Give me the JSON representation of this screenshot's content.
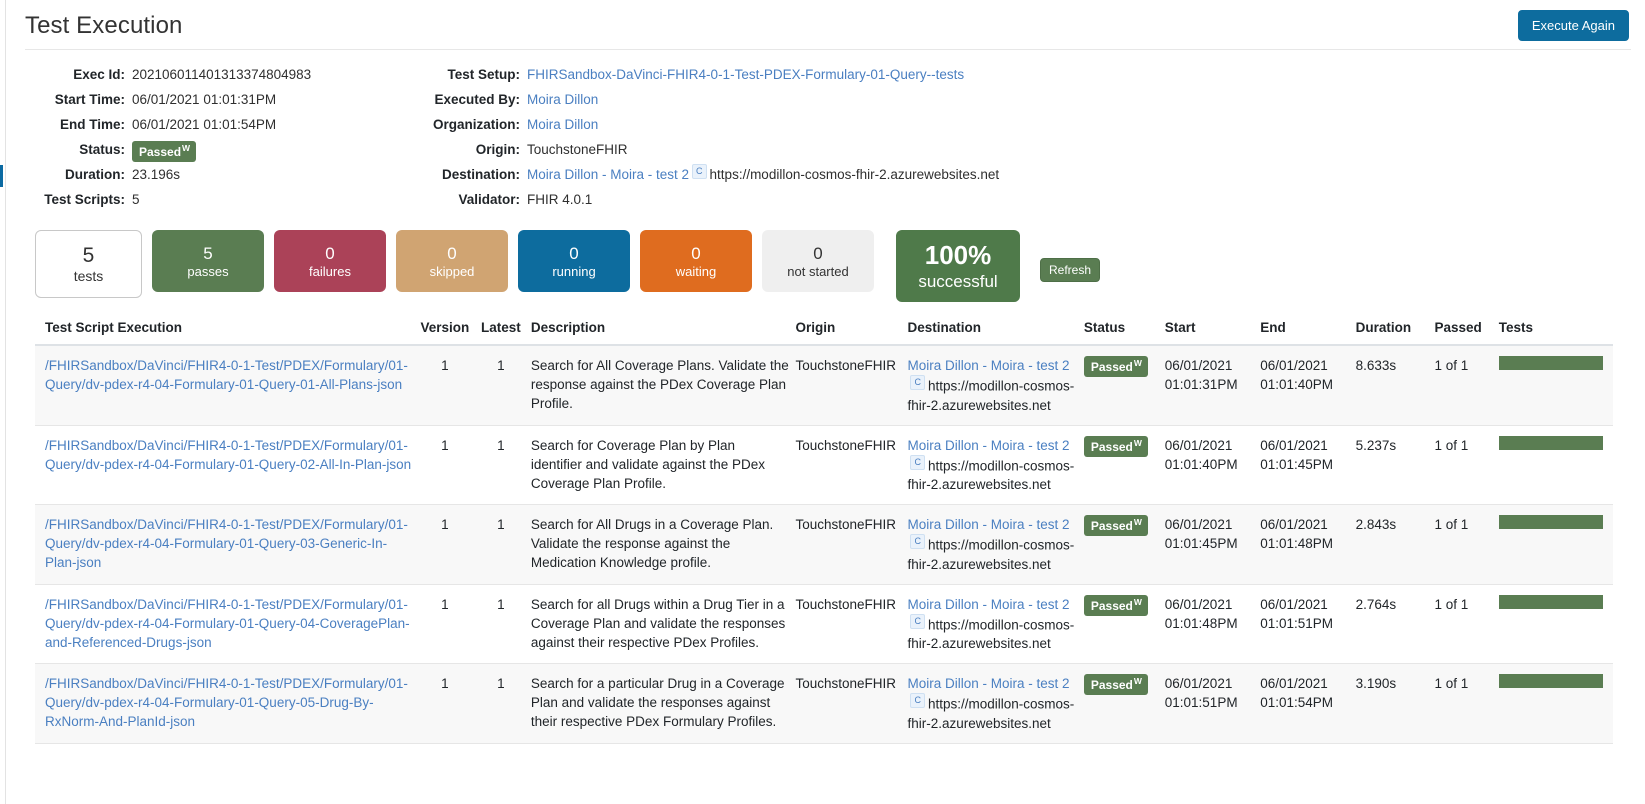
{
  "header": {
    "title": "Test Execution",
    "execute_again_label": "Execute Again"
  },
  "details": {
    "left": [
      {
        "label": "Exec Id:",
        "value": "202106011401313374804983",
        "type": "text"
      },
      {
        "label": "Start Time:",
        "value": "06/01/2021 01:01:31PM",
        "type": "text"
      },
      {
        "label": "End Time:",
        "value": "06/01/2021 01:01:54PM",
        "type": "text"
      },
      {
        "label": "Status:",
        "value": "Passed",
        "sup": "W",
        "type": "badge"
      },
      {
        "label": "Duration:",
        "value": "23.196s",
        "type": "text"
      },
      {
        "label": "Test Scripts:",
        "value": "5",
        "type": "text"
      }
    ],
    "right": [
      {
        "label": "Test Setup:",
        "value": "FHIRSandbox-DaVinci-FHIR4-0-1-Test-PDEX-Formulary-01-Query--tests",
        "type": "link"
      },
      {
        "label": "Executed By:",
        "value": "Moira Dillon",
        "type": "link"
      },
      {
        "label": "Organization:",
        "value": "Moira Dillon",
        "type": "link"
      },
      {
        "label": "Origin:",
        "value": "TouchstoneFHIR",
        "type": "text"
      },
      {
        "label": "Destination:",
        "value": "Moira Dillon - Moira - test 2",
        "badge": "C",
        "suffix": "https://modillon-cosmos-fhir-2.azurewebsites.net",
        "type": "link-badge"
      },
      {
        "label": "Validator:",
        "value": "FHIR 4.0.1",
        "type": "text"
      }
    ]
  },
  "stats": {
    "items": [
      {
        "num": "5",
        "label": "tests",
        "style": "tests",
        "color": "#ffffff"
      },
      {
        "num": "5",
        "label": "passes",
        "style": "passes",
        "color": "#5a7d52"
      },
      {
        "num": "0",
        "label": "failures",
        "style": "failures",
        "color": "#ab4258"
      },
      {
        "num": "0",
        "label": "skipped",
        "style": "skipped",
        "color": "#d0a472"
      },
      {
        "num": "0",
        "label": "running",
        "style": "running",
        "color": "#0d6c9e"
      },
      {
        "num": "0",
        "label": "waiting",
        "style": "waiting",
        "color": "#df6c1f"
      },
      {
        "num": "0",
        "label": "not started",
        "style": "notstarted",
        "color": "#efefef"
      }
    ],
    "percent": {
      "num": "100%",
      "label": "successful",
      "color": "#4f7a4a"
    },
    "refresh_label": "Refresh"
  },
  "table": {
    "columns": [
      "Test Script Execution",
      "Version",
      "Latest",
      "Description",
      "Origin",
      "Destination",
      "Status",
      "Start",
      "End",
      "Duration",
      "Passed",
      "Tests"
    ],
    "rows": [
      {
        "script": "/FHIRSandbox/DaVinci/FHIR4-0-1-Test/PDEX/Formulary/01-Query/dv-pdex-r4-04-Formulary-01-Query-01-All-Plans-json",
        "version": "1",
        "latest": "1",
        "description": "Search for All Coverage Plans. Validate the response against the PDex Coverage Plan Profile.",
        "origin": "TouchstoneFHIR",
        "destination_name": "Moira Dillon - Moira - test 2",
        "destination_badge": "C",
        "destination_url": "https://modillon-cosmos-fhir-2.azurewebsites.net",
        "status": "Passed",
        "status_sup": "W",
        "start_date": "06/01/2021",
        "start_time": "01:01:31PM",
        "end_date": "06/01/2021",
        "end_time": "01:01:40PM",
        "duration": "8.633s",
        "passed": "1 of 1",
        "tests_bar_pct": 100
      },
      {
        "script": "/FHIRSandbox/DaVinci/FHIR4-0-1-Test/PDEX/Formulary/01-Query/dv-pdex-r4-04-Formulary-01-Query-02-All-In-Plan-json",
        "version": "1",
        "latest": "1",
        "description": "Search for Coverage Plan by Plan identifier and validate against the PDex Coverage Plan Profile.",
        "origin": "TouchstoneFHIR",
        "destination_name": "Moira Dillon - Moira - test 2",
        "destination_badge": "C",
        "destination_url": "https://modillon-cosmos-fhir-2.azurewebsites.net",
        "status": "Passed",
        "status_sup": "W",
        "start_date": "06/01/2021",
        "start_time": "01:01:40PM",
        "end_date": "06/01/2021",
        "end_time": "01:01:45PM",
        "duration": "5.237s",
        "passed": "1 of 1",
        "tests_bar_pct": 100
      },
      {
        "script": "/FHIRSandbox/DaVinci/FHIR4-0-1-Test/PDEX/Formulary/01-Query/dv-pdex-r4-04-Formulary-01-Query-03-Generic-In-Plan-json",
        "version": "1",
        "latest": "1",
        "description": "Search for All Drugs in a Coverage Plan. Validate the response against the Medication Knowledge profile.",
        "origin": "TouchstoneFHIR",
        "destination_name": "Moira Dillon - Moira - test 2",
        "destination_badge": "C",
        "destination_url": "https://modillon-cosmos-fhir-2.azurewebsites.net",
        "status": "Passed",
        "status_sup": "W",
        "start_date": "06/01/2021",
        "start_time": "01:01:45PM",
        "end_date": "06/01/2021",
        "end_time": "01:01:48PM",
        "duration": "2.843s",
        "passed": "1 of 1",
        "tests_bar_pct": 100
      },
      {
        "script": "/FHIRSandbox/DaVinci/FHIR4-0-1-Test/PDEX/Formulary/01-Query/dv-pdex-r4-04-Formulary-01-Query-04-CoveragePlan-and-Referenced-Drugs-json",
        "version": "1",
        "latest": "1",
        "description": "Search for all Drugs within a Drug Tier in a Coverage Plan and validate the responses against their respective PDex Profiles.",
        "origin": "TouchstoneFHIR",
        "destination_name": "Moira Dillon - Moira - test 2",
        "destination_badge": "C",
        "destination_url": "https://modillon-cosmos-fhir-2.azurewebsites.net",
        "status": "Passed",
        "status_sup": "W",
        "start_date": "06/01/2021",
        "start_time": "01:01:48PM",
        "end_date": "06/01/2021",
        "end_time": "01:01:51PM",
        "duration": "2.764s",
        "passed": "1 of 1",
        "tests_bar_pct": 100
      },
      {
        "script": "/FHIRSandbox/DaVinci/FHIR4-0-1-Test/PDEX/Formulary/01-Query/dv-pdex-r4-04-Formulary-01-Query-05-Drug-By-RxNorm-And-PlanId-json",
        "version": "1",
        "latest": "1",
        "description": "Search for a particular Drug in a Coverage Plan and validate the responses against their respective PDex Formulary Profiles.",
        "origin": "TouchstoneFHIR",
        "destination_name": "Moira Dillon - Moira - test 2",
        "destination_badge": "C",
        "destination_url": "https://modillon-cosmos-fhir-2.azurewebsites.net",
        "status": "Passed",
        "status_sup": "W",
        "start_date": "06/01/2021",
        "start_time": "01:01:51PM",
        "end_date": "06/01/2021",
        "end_time": "01:01:54PM",
        "duration": "3.190s",
        "passed": "1 of 1",
        "tests_bar_pct": 100
      }
    ]
  }
}
